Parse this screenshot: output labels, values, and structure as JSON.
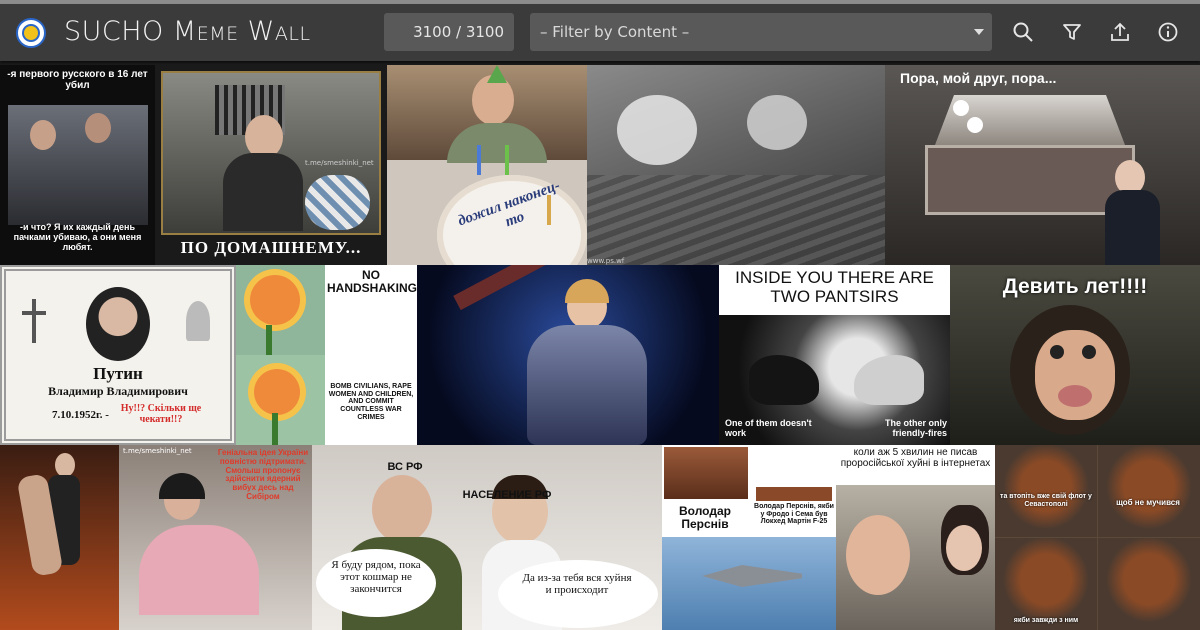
{
  "app": {
    "title_big_1": "SUCHO",
    "title_rest": "Meme Wall",
    "counter": "3100 / 3100",
    "filter_placeholder": "– Filter by Content –"
  },
  "icons": [
    "search-icon",
    "filter-icon",
    "upload-icon",
    "info-icon"
  ],
  "colors": {
    "header": "#3b3b3b",
    "control": "#595959",
    "background": "#1c1c1c"
  },
  "memes": {
    "m1_top": "-я первого русского в 16 лет убил",
    "m1_bottom": "-и что? Я их каждый день пачками убиваю, а они меня любят.",
    "m2_caption": "ПО ДОМАШНЕМУ...",
    "m2_wm": "t.me/smeshinki_net",
    "m3_cake": "дожил наконец-то",
    "m5_top": "Пора, мой друг, пора...",
    "m6_name": "Путин",
    "m6_patronymic": "Владимир Владимирович",
    "m6_date": "7.10.1952г. -",
    "m6_red": "Ну!!? Скільки ще чекати!!?",
    "m8_top": "NO HANDSHAKING",
    "m8_bottom": "BOMB CIVILIANS, RAPE WOMEN AND CHILDREN, AND COMMIT COUNTLESS WAR CRIMES",
    "m10_top": "INSIDE YOU THERE ARE TWO PANTSIRS",
    "m10_left": "One of them doesn't work",
    "m10_right": "The other only friendly-fires",
    "m11_top": "Девить лет!!!!",
    "m13_red": "Геніальна ідея України повністю підтримати. Смолыш пропонує здійснити ядерний вибух десь над Сибіром",
    "m14_left_tag": "ВС РФ",
    "m14_right_tag": "НАСЕЛЕНИЕ РФ",
    "m14_left_bubble": "Я буду рядом, пока этот кошмар не закончится",
    "m14_right_bubble": "Да из-за тебя вся хуйня и происходит",
    "m15_left": "Володар Перснів",
    "m15_right": "Володар Перснів, якби у Фродо і Сема був Локхед Мартін F-25",
    "m16_top": "коли аж 5 хвилин не писав проросійської хуйні в інтернетах",
    "m17_mid": "та втопіть вже свій флот у Севастополі",
    "m17_right": "щоб не мучився",
    "m17_bottom": "якби завжди з ним",
    "m17_wm": "t.me/smeshinki_net"
  }
}
